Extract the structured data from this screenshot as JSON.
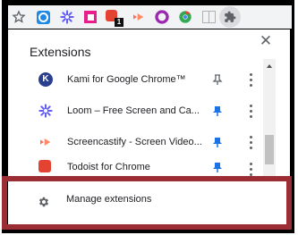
{
  "toolbar": {
    "icons": [
      "star-icon",
      "loom-icon",
      "screencastify-icon",
      "kami-icon",
      "todoist-icon",
      "color-icon",
      "panel-icon",
      "puzzle-icon"
    ],
    "badge": "1"
  },
  "panel": {
    "title": "Extensions",
    "items": [
      {
        "name": "Kami for Google Chrome™",
        "pinned": false
      },
      {
        "name": "Loom – Free Screen and Ca...",
        "pinned": true
      },
      {
        "name": "Screencastify - Screen Video...",
        "pinned": true
      },
      {
        "name": "Todoist for Chrome",
        "pinned": true
      }
    ],
    "manage_label": "Manage extensions"
  },
  "colors": {
    "pin_active": "#1a73e8",
    "highlight": "#9c2d34",
    "kami": "#2a3f8f",
    "loom": "#625df5",
    "screencastify": "#ff6d5a",
    "todoist": "#e44332"
  }
}
